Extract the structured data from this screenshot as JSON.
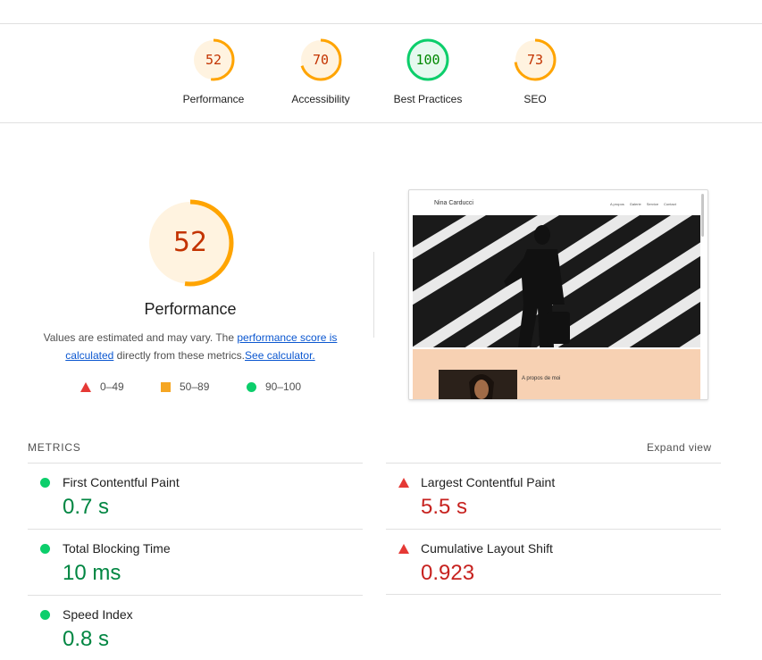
{
  "colors": {
    "pass": "#0cce6b",
    "average": "#ffa400",
    "fail": "#ff4e42",
    "pass_text": "#008800",
    "average_text": "#c33300",
    "fail_text": "#cc0000"
  },
  "top_gauges": [
    {
      "score": "52",
      "label": "Performance",
      "value": 52,
      "rating": "average"
    },
    {
      "score": "70",
      "label": "Accessibility",
      "value": 70,
      "rating": "average"
    },
    {
      "score": "100",
      "label": "Best Practices",
      "value": 100,
      "rating": "pass"
    },
    {
      "score": "73",
      "label": "SEO",
      "value": 73,
      "rating": "average"
    }
  ],
  "main_gauge": {
    "score": "52",
    "value": 52,
    "title": "Performance"
  },
  "description": {
    "prefix": "Values are estimated and may vary. The ",
    "link1": "performance score is calculated",
    "middle": " directly from these metrics.",
    "link2": "See calculator."
  },
  "legend": [
    {
      "icon": "triangle-icon",
      "label": "0–49"
    },
    {
      "icon": "square-icon",
      "label": "50–89"
    },
    {
      "icon": "circle-icon",
      "label": "90–100"
    }
  ],
  "screenshot": {
    "site_name": "Nina Carducci",
    "nav": [
      "A propos",
      "Galerie",
      "Service",
      "Contact"
    ],
    "section_title": "A propos de moi"
  },
  "metrics": {
    "title": "METRICS",
    "expand_label": "Expand view",
    "items": [
      {
        "name": "First Contentful Paint",
        "value": "0.7 s",
        "rating": "pass",
        "icon": "circle-icon"
      },
      {
        "name": "Largest Contentful Paint",
        "value": "5.5 s",
        "rating": "fail",
        "icon": "triangle-icon"
      },
      {
        "name": "Total Blocking Time",
        "value": "10 ms",
        "rating": "pass",
        "icon": "circle-icon"
      },
      {
        "name": "Cumulative Layout Shift",
        "value": "0.923",
        "rating": "fail",
        "icon": "triangle-icon"
      },
      {
        "name": "Speed Index",
        "value": "0.8 s",
        "rating": "pass",
        "icon": "circle-icon"
      }
    ]
  }
}
